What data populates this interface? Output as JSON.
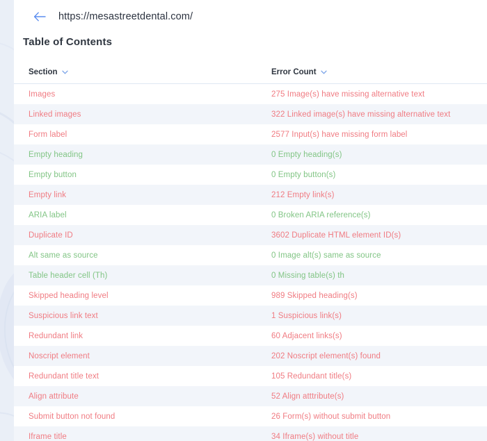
{
  "header": {
    "back_icon": "arrow-left-icon",
    "url": "https://mesastreetdental.com/"
  },
  "page_title": "Table of Contents",
  "table": {
    "columns": [
      {
        "label": "Section",
        "sort_icon": "chevron-down-icon"
      },
      {
        "label": "Error Count",
        "sort_icon": "chevron-down-icon"
      }
    ],
    "rows": [
      {
        "section": "Images",
        "count": "275 Image(s) have missing alternative text",
        "severity": "error"
      },
      {
        "section": "Linked images",
        "count": "322 Linked image(s) have missing alternative text",
        "severity": "error"
      },
      {
        "section": "Form label",
        "count": "2577 Input(s) have missing form label",
        "severity": "error"
      },
      {
        "section": "Empty heading",
        "count": "0 Empty heading(s)",
        "severity": "ok"
      },
      {
        "section": "Empty button",
        "count": "0 Empty button(s)",
        "severity": "ok"
      },
      {
        "section": "Empty link",
        "count": "212 Empty link(s)",
        "severity": "error"
      },
      {
        "section": "ARIA label",
        "count": "0 Broken ARIA reference(s)",
        "severity": "ok"
      },
      {
        "section": "Duplicate ID",
        "count": "3602 Duplicate HTML element ID(s)",
        "severity": "error"
      },
      {
        "section": "Alt same as source",
        "count": "0 Image alt(s) same as source",
        "severity": "ok"
      },
      {
        "section": "Table header cell (Th)",
        "count": "0 Missing table(s) th",
        "severity": "ok"
      },
      {
        "section": "Skipped heading level",
        "count": "989 Skipped heading(s)",
        "severity": "error"
      },
      {
        "section": "Suspicious link text",
        "count": "1 Suspicious link(s)",
        "severity": "error"
      },
      {
        "section": "Redundant link",
        "count": "60 Adjacent links(s)",
        "severity": "error"
      },
      {
        "section": "Noscript element",
        "count": "202 Noscript element(s) found",
        "severity": "error"
      },
      {
        "section": "Redundant title text",
        "count": "105 Redundant title(s)",
        "severity": "error"
      },
      {
        "section": "Align attribute",
        "count": "52 Align atttribute(s)",
        "severity": "error"
      },
      {
        "section": "Submit button not found",
        "count": "26 Form(s) without submit button",
        "severity": "error"
      },
      {
        "section": "Iframe title",
        "count": "34 Iframe(s) without title",
        "severity": "error"
      }
    ]
  },
  "colors": {
    "error": "#f07b82",
    "ok": "#82c585",
    "accent": "#5b8def",
    "row_alt": "#f2f5fa",
    "backdrop": "#eaeff7"
  }
}
